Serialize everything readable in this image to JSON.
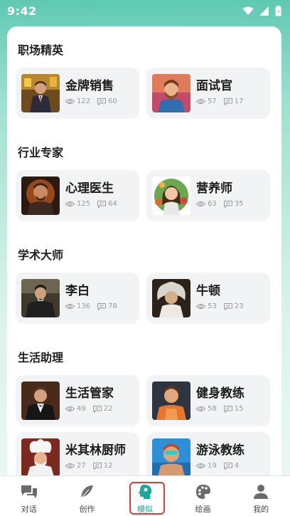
{
  "status": {
    "time": "9:42"
  },
  "sections": [
    {
      "title": "职场精英",
      "cards": [
        {
          "name": "金牌销售",
          "views": "122",
          "comments": "60",
          "avatar": "salesman-portrait"
        },
        {
          "name": "面试官",
          "views": "57",
          "comments": "17",
          "avatar": "interviewer-portrait"
        }
      ]
    },
    {
      "title": "行业专家",
      "cards": [
        {
          "name": "心理医生",
          "views": "125",
          "comments": "64",
          "avatar": "psychologist-portrait"
        },
        {
          "name": "营养师",
          "views": "63",
          "comments": "35",
          "avatar": "nutritionist-portrait"
        }
      ]
    },
    {
      "title": "学术大师",
      "cards": [
        {
          "name": "李白",
          "views": "136",
          "comments": "78",
          "avatar": "libai-portrait"
        },
        {
          "name": "牛顿",
          "views": "53",
          "comments": "23",
          "avatar": "newton-portrait"
        }
      ]
    },
    {
      "title": "生活助理",
      "cards": [
        {
          "name": "生活管家",
          "views": "49",
          "comments": "22",
          "avatar": "butler-portrait"
        },
        {
          "name": "健身教练",
          "views": "58",
          "comments": "15",
          "avatar": "fitness-coach-portrait"
        },
        {
          "name": "米其林厨师",
          "views": "27",
          "comments": "12",
          "avatar": "chef-portrait"
        },
        {
          "name": "游泳教练",
          "views": "19",
          "comments": "4",
          "avatar": "swim-coach-portrait"
        }
      ]
    }
  ],
  "tabs": [
    {
      "label": "对话",
      "icon": "chat-bubbles-icon"
    },
    {
      "label": "创作",
      "icon": "feather-icon"
    },
    {
      "label": "模拟",
      "icon": "head-profile-icon",
      "active": true
    },
    {
      "label": "绘画",
      "icon": "palette-icon"
    },
    {
      "label": "我的",
      "icon": "person-icon"
    }
  ],
  "colors": {
    "accent": "#1aa89a",
    "highlight_box": "#e53935",
    "card_bg": "#f1f3f4"
  }
}
